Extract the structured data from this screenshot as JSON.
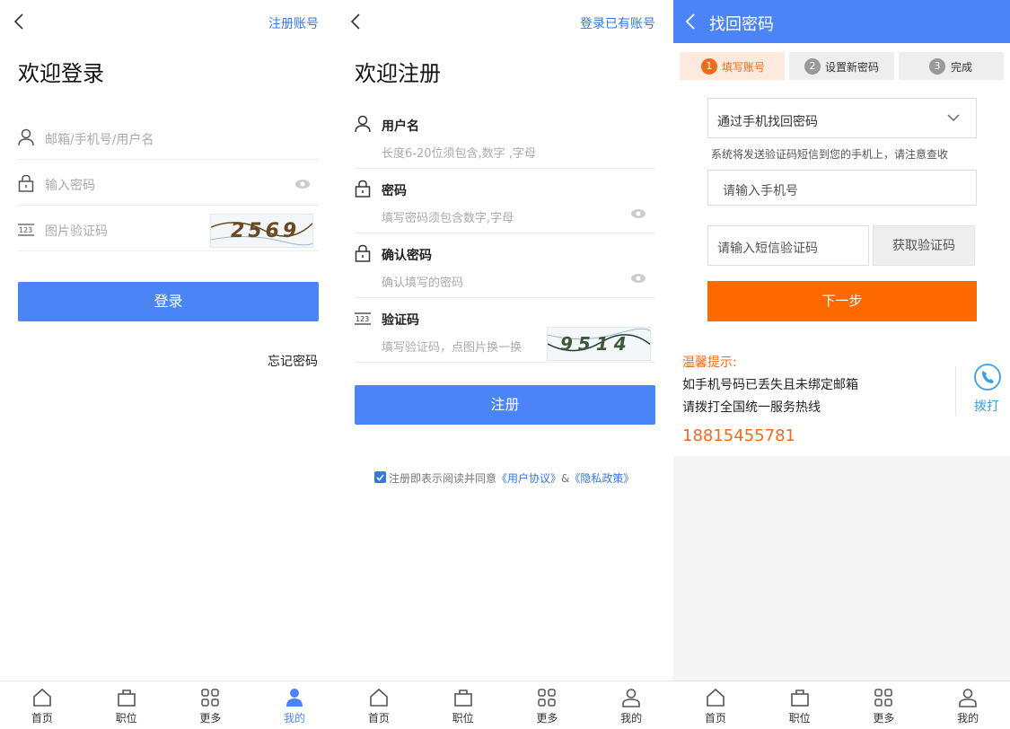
{
  "login": {
    "register_link": "注册账号",
    "title": "欢迎登录",
    "account_placeholder": "邮箱/手机号/用户名",
    "password_placeholder": "输入密码",
    "captcha_placeholder": "图片验证码",
    "captcha_text": "2569",
    "login_button": "登录",
    "forgot_link": "忘记密码"
  },
  "register": {
    "login_link": "登录已有账号",
    "title": "欢迎注册",
    "username_label": "用户名",
    "username_hint": "长度6-20位须包含,数字 ,字母",
    "password_label": "密码",
    "password_hint": "填写密码须包含数字,字母",
    "confirm_label": "确认密码",
    "confirm_hint": "确认填写的密码",
    "captcha_label": "验证码",
    "captcha_hint": "填写验证码，点图片换一换",
    "captcha_text": "9514",
    "register_button": "注册",
    "agree_prefix": "注册即表示阅读并同意",
    "agreement_link": "《用户协议》",
    "and": "&",
    "privacy_link": "《隐私政策》"
  },
  "recover": {
    "title": "找回密码",
    "steps": [
      {
        "num": "1",
        "label": "填写账号"
      },
      {
        "num": "2",
        "label": "设置新密码"
      },
      {
        "num": "3",
        "label": "完成"
      }
    ],
    "method_select": "通过手机找回密码",
    "notice": "系统将发送验证码短信到您的手机上，请注意查收",
    "phone_placeholder": "请输入手机号",
    "sms_placeholder": "请输入短信验证码",
    "get_code_button": "获取验证码",
    "next_button": "下一步",
    "tips_title": "温馨提示:",
    "tips_line1": "如手机号码已丢失且未绑定邮箱",
    "tips_line2": "请拨打全国统一服务热线",
    "hotline": "18815455781",
    "call_label": "拨打"
  },
  "nav": {
    "home": "首页",
    "jobs": "职位",
    "more": "更多",
    "mine": "我的"
  },
  "colors": {
    "primary_blue": "#4b84f7",
    "accent_orange": "#ff6a00",
    "link_blue": "#3478e0"
  }
}
